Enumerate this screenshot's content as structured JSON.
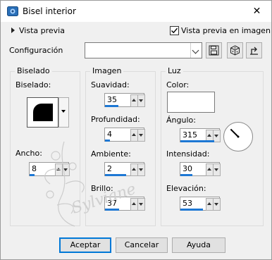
{
  "window": {
    "title": "Bisel interior",
    "close_glyph": "✕",
    "icon": "bevel-app-icon"
  },
  "top": {
    "preview_link": "Vista previa",
    "preview_checkbox_label": "Vista previa en imagen",
    "preview_checked": true,
    "config_label": "Configuración",
    "config_value": "",
    "toolbar": [
      "save-preset-icon",
      "randomize-dice-icon",
      "reset-icon"
    ]
  },
  "biselado": {
    "title": "Biselado",
    "bevel_label": "Biselado:",
    "width_label": "Ancho:",
    "width_value": "8",
    "width_fraction": 0.2
  },
  "imagen": {
    "title": "Imagen",
    "fields": [
      {
        "label": "Suavidad:",
        "value": "35",
        "fraction": 0.35
      },
      {
        "label": "Profundidad:",
        "value": "4",
        "fraction": 0.12
      },
      {
        "label": "Ambiente:",
        "value": "2",
        "fraction": 0.55
      },
      {
        "label": "Brillo:",
        "value": "37",
        "fraction": 0.37
      }
    ]
  },
  "luz": {
    "title": "Luz",
    "color_label": "Color:",
    "color_value": "#ffffff",
    "angle_label": "Ángulo:",
    "angle_value": "315",
    "angle_fraction": 0.875,
    "intensity_label": "Intensidad:",
    "intensity_value": "30",
    "intensity_fraction": 0.3,
    "elevation_label": "Elevación:",
    "elevation_value": "53",
    "elevation_fraction": 0.59
  },
  "watermark_text": "Sylviane",
  "buttons": {
    "ok": "Aceptar",
    "cancel": "Cancelar",
    "help": "Ayuda"
  },
  "colors": {
    "accent": "#1e78d4",
    "default_border": "#0078d7"
  }
}
